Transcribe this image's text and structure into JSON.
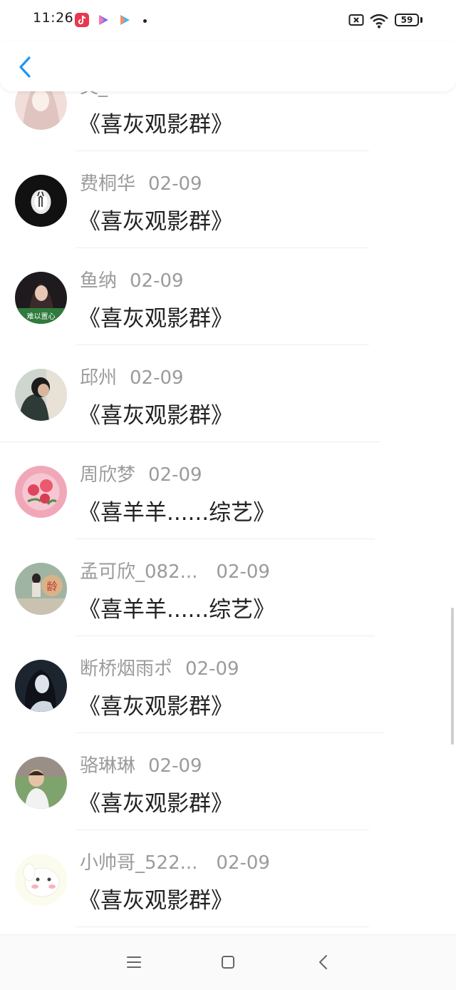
{
  "status_bar": {
    "time": "11:26",
    "battery": "59",
    "icons": [
      "douyin-app-icon",
      "video-app-icon",
      "video-app-icon-2",
      "notification-dot",
      "sim-off-icon",
      "wifi-icon",
      "battery-icon"
    ]
  },
  "header": {
    "back_icon": "chevron-left-icon",
    "accent": "#2196f3"
  },
  "items": [
    {
      "name": "英_",
      "date": "",
      "title": "《喜灰观影群》"
    },
    {
      "name": "费桐华",
      "date": "02-09",
      "title": "《喜灰观影群》"
    },
    {
      "name": "鱼纳",
      "date": "02-09",
      "title": "《喜灰观影群》",
      "avatar_text": "难以置心"
    },
    {
      "name": "邱州",
      "date": "02-09",
      "title": "《喜灰观影群》"
    },
    {
      "name": "周欣梦",
      "date": "02-09",
      "title": "《喜羊羊......综艺》"
    },
    {
      "name": "孟可欣_082...",
      "date": "02-09",
      "title": "《喜羊羊......综艺》",
      "avatar_text": "龄"
    },
    {
      "name": "断桥烟雨ポ",
      "date": "02-09",
      "title": "《喜灰观影群》"
    },
    {
      "name": "骆琳琳",
      "date": "02-09",
      "title": "《喜灰观影群》"
    },
    {
      "name": "小帅哥_522...",
      "date": "02-09",
      "title": "《喜灰观影群》"
    }
  ],
  "nav": {
    "icons": [
      "menu-icon",
      "home-square-icon",
      "back-triangle-icon"
    ]
  }
}
